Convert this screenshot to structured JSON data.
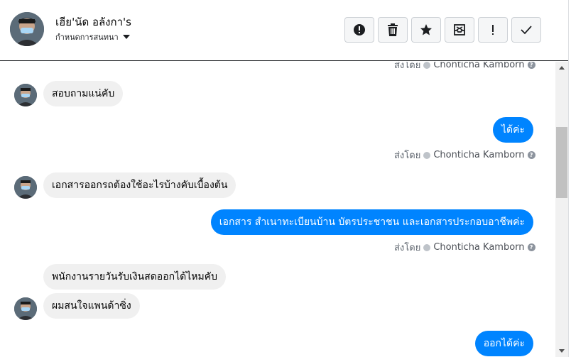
{
  "header": {
    "contact_name": "เฮีย'นัด อลังกา's",
    "conversation_settings": "กำหนดการสนทนา",
    "actions": [
      {
        "name": "report-spam",
        "icon": "alert-circle-icon"
      },
      {
        "name": "delete",
        "icon": "trash-icon"
      },
      {
        "name": "star",
        "icon": "star-icon"
      },
      {
        "name": "archive",
        "icon": "inbox-archive-icon"
      },
      {
        "name": "mark-important",
        "icon": "exclamation-icon"
      },
      {
        "name": "mark-done",
        "icon": "check-icon"
      }
    ]
  },
  "messages": {
    "sent_by_label": "ส่งโดย",
    "agent_name": "Chonticha Kamborn",
    "m1": "สอบถามแน่คับ",
    "m2": "ได้ค่ะ",
    "m3": "เอกสารออกรถต้องใช้อะไรบ้างคับเบื้องต้น",
    "m4": "เอกสาร สำเนาทะเบียนบ้าน บัตรประชาชน และเอกสารประกอบอาชีพค่ะ",
    "m5": "พนักงานรายวันรับเงินสดออกได้ไหมคับ",
    "m6": "ผมสนใจแพนด้าซิ่ง",
    "m7": "ออกได้ค่ะ"
  },
  "colors": {
    "outgoing_bubble": "#0084ff",
    "incoming_bubble": "#f0f0f0",
    "muted_text": "#606770"
  }
}
